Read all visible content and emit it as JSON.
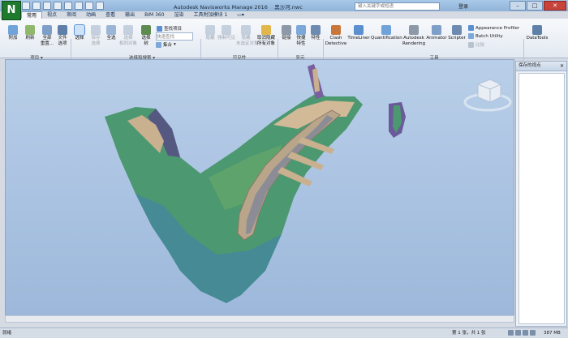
{
  "app": {
    "title": "Autodesk Navisworks Manage 2016",
    "file_name": "黑沙河.nwc",
    "logo": "N",
    "search_placeholder": "键入关键字或短语",
    "login": "登录"
  },
  "tabs": [
    "常用",
    "视点",
    "审阅",
    "动画",
    "查看",
    "输出",
    "BIM 360",
    "渲染",
    "工具附加模块 1"
  ],
  "active_tab": "常用",
  "ribbon": {
    "project": {
      "label": "项目",
      "buttons": [
        {
          "label": "附加",
          "icon": "attach-icon"
        },
        {
          "label": "刷新",
          "icon": "refresh-icon"
        },
        {
          "label": "全部\n重置...",
          "icon": "reset-all-icon"
        },
        {
          "label": "文件\n选项",
          "icon": "file-options-icon"
        }
      ]
    },
    "select": {
      "label": "选择和搜索",
      "buttons": [
        {
          "label": "选择",
          "icon": "select-cursor-icon",
          "selected": true
        },
        {
          "label": "保存\n选择",
          "icon": "save-selection-icon",
          "disabled": true
        },
        {
          "label": "全选",
          "icon": "select-all-icon"
        },
        {
          "label": "选择\n相同对象",
          "icon": "select-same-icon",
          "disabled": true
        },
        {
          "label": "选择\n树",
          "icon": "selection-tree-icon"
        }
      ],
      "find_items": "查找项目",
      "quick_find_placeholder": "快速查找",
      "sets_label": "集合"
    },
    "visibility": {
      "label": "可见性",
      "buttons": [
        {
          "label": "隐藏",
          "icon": "hide-icon",
          "disabled": true
        },
        {
          "label": "强制可见",
          "icon": "require-icon",
          "disabled": true
        },
        {
          "label": "隐藏\n未选定对象",
          "icon": "hide-unselected-icon",
          "disabled": true
        },
        {
          "label": "取消隐藏\n所有对象",
          "icon": "unhide-all-icon"
        }
      ]
    },
    "display": {
      "label": "显示",
      "buttons": [
        {
          "label": "链接",
          "icon": "links-icon"
        },
        {
          "label": "快捷\n特性",
          "icon": "quick-properties-icon"
        },
        {
          "label": "特性",
          "icon": "properties-icon"
        }
      ]
    },
    "tools": {
      "label": "工具",
      "buttons": [
        {
          "label": "Clash\nDetective",
          "icon": "clash-detective-icon"
        },
        {
          "label": "TimeLiner",
          "icon": "timeliner-icon"
        },
        {
          "label": "Quantification",
          "icon": "quantification-icon"
        },
        {
          "label": "Autodesk\nRendering",
          "icon": "rendering-icon"
        },
        {
          "label": "Animator",
          "icon": "animator-icon"
        },
        {
          "label": "Scripter",
          "icon": "scripter-icon"
        }
      ],
      "small": [
        {
          "label": "Appearance Profiler",
          "icon": "appearance-profiler-icon"
        },
        {
          "label": "Batch Utility",
          "icon": "batch-utility-icon"
        },
        {
          "label": "比较",
          "icon": "compare-icon",
          "disabled": true
        }
      ]
    },
    "datatools": {
      "label": "DataTools",
      "icon": "datatools-icon"
    }
  },
  "panel": {
    "title": "保存的视点"
  },
  "status": {
    "left": "就绪",
    "page": "第 1 张，共 1 张",
    "memory": "387 MB"
  },
  "colors": {
    "viewport_sky": "#a8c2e2",
    "terrain_green": "#4f9a6e",
    "terrain_blue": "#3d78b8",
    "road_tan": "#c9b08e"
  }
}
